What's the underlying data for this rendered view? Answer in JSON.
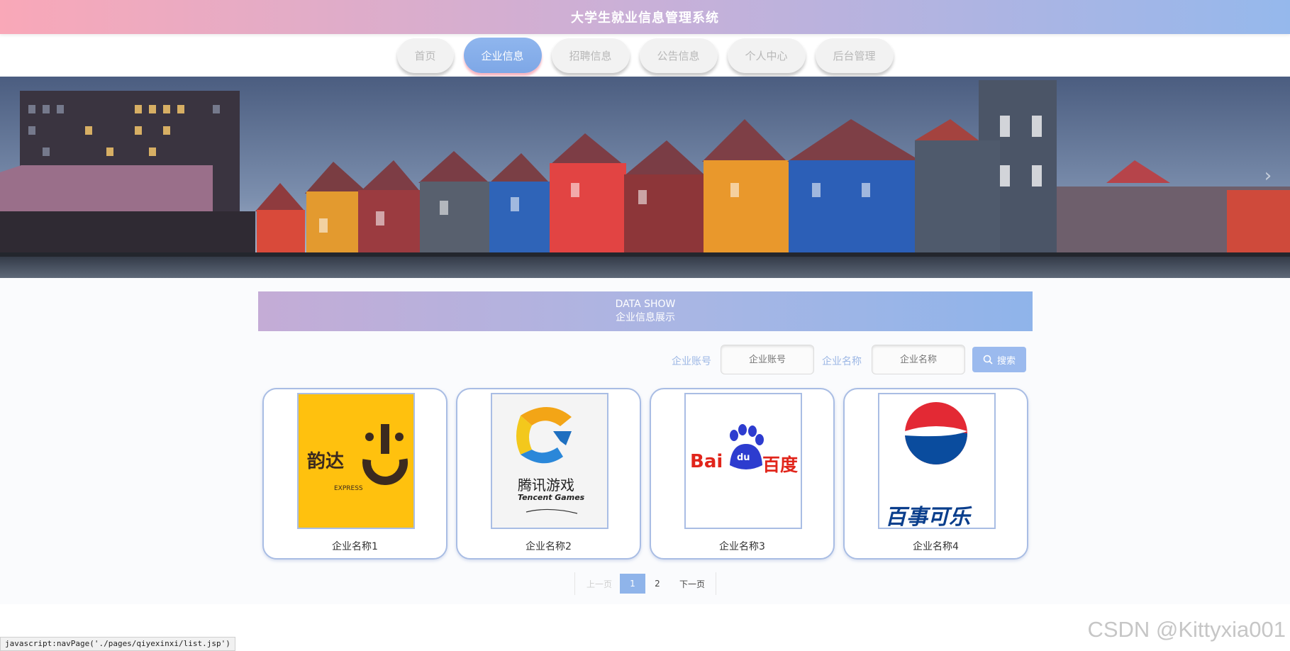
{
  "header": {
    "title": "大学生就业信息管理系统"
  },
  "nav": {
    "items": [
      {
        "label": "首页",
        "active": false
      },
      {
        "label": "企业信息",
        "active": true
      },
      {
        "label": "招聘信息",
        "active": false
      },
      {
        "label": "公告信息",
        "active": false
      },
      {
        "label": "个人中心",
        "active": false
      },
      {
        "label": "后台管理",
        "active": false
      }
    ]
  },
  "banner": {
    "next_arrow": "›"
  },
  "section": {
    "title_en": "DATA SHOW",
    "title_cn": "企业信息展示"
  },
  "search": {
    "account_label": "企业账号",
    "account_placeholder": "企业账号",
    "name_label": "企业名称",
    "name_placeholder": "企业名称",
    "button_label": "搜索",
    "button_icon": "search-icon"
  },
  "cards": [
    {
      "name": "企业名称1",
      "logo_text": "韵达",
      "logo_sub": "EXPRESS"
    },
    {
      "name": "企业名称2",
      "logo_text": "腾讯游戏",
      "logo_sub": "Tencent Games"
    },
    {
      "name": "企业名称3",
      "logo_text": "Bai",
      "logo_text2": "du",
      "logo_text3": "百度"
    },
    {
      "name": "企业名称4",
      "logo_text": "百事可乐"
    }
  ],
  "pagination": {
    "prev": "上一页",
    "pages": [
      "1",
      "2"
    ],
    "current": "1",
    "next": "下一页"
  },
  "statusbar": {
    "text": "javascript:navPage('./pages/qiyexinxi/list.jsp')"
  },
  "watermark": {
    "text": "CSDN @Kittyxia001"
  },
  "colors": {
    "accent": "#8fb4ea",
    "header_left": "#f9a8b8",
    "header_right": "#95b8ec"
  }
}
